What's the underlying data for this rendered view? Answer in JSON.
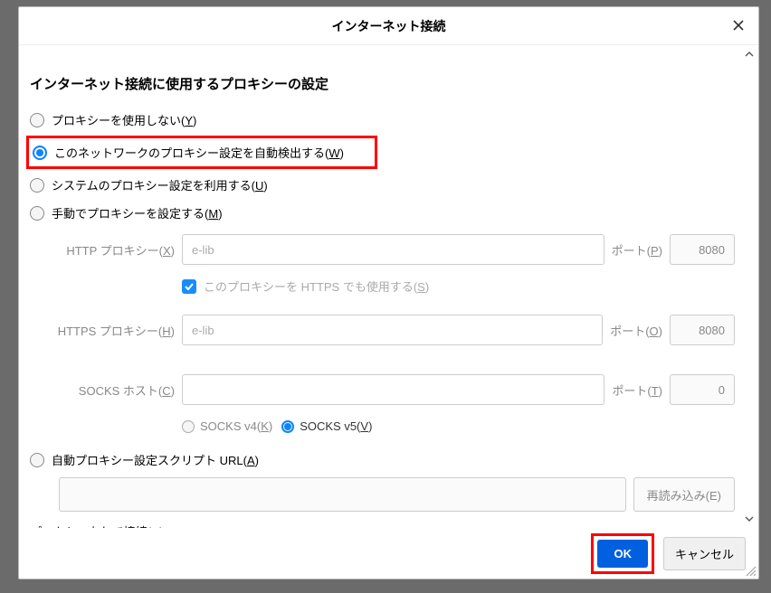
{
  "title": "インターネット接続",
  "heading": "インターネット接続に使用するプロキシーの設定",
  "radios": {
    "none": {
      "label": "プロキシーを使用しない(",
      "mnemonic": "Y",
      "suffix": ")",
      "selected": false
    },
    "auto": {
      "label": "このネットワークのプロキシー設定を自動検出する(",
      "mnemonic": "W",
      "suffix": ")",
      "selected": true
    },
    "system": {
      "label": "システムのプロキシー設定を利用する(",
      "mnemonic": "U",
      "suffix": ")",
      "selected": false
    },
    "manual": {
      "label": "手動でプロキシーを設定する(",
      "mnemonic": "M",
      "suffix": ")",
      "selected": false
    },
    "pac": {
      "label": "自動プロキシー設定スクリプト URL(",
      "mnemonic": "A",
      "suffix": ")",
      "selected": false
    }
  },
  "fields": {
    "http": {
      "label": "HTTP プロキシー(",
      "mnemonic": "X",
      "suffix": ")",
      "value": "e-lib",
      "port_label": "ポート(",
      "port_mnemonic": "P",
      "port_suffix": ")",
      "port": "8080"
    },
    "https_checkbox": {
      "label": "このプロキシーを HTTPS でも使用する(",
      "mnemonic": "S",
      "suffix": ")",
      "checked": true
    },
    "https": {
      "label": "HTTPS プロキシー(",
      "mnemonic": "H",
      "suffix": ")",
      "value": "e-lib",
      "port_label": "ポート(",
      "port_mnemonic": "O",
      "port_suffix": ")",
      "port": "8080"
    },
    "socks": {
      "label": "SOCKS ホスト(",
      "mnemonic": "C",
      "suffix": ")",
      "value": "",
      "port_label": "ポート(",
      "port_mnemonic": "T",
      "port_suffix": ")",
      "port": "0"
    },
    "socks_v4": {
      "label": "SOCKS v4(",
      "mnemonic": "K",
      "suffix": ")",
      "selected": false
    },
    "socks_v5": {
      "label": "SOCKS v5(",
      "mnemonic": "V",
      "suffix": ")",
      "selected": true
    },
    "reload": "再読み込み(E)",
    "noproxy": {
      "label": "プロキシーなしで接続(",
      "mnemonic": "N",
      "suffix": ")"
    }
  },
  "buttons": {
    "ok": "OK",
    "cancel": "キャンセル"
  }
}
